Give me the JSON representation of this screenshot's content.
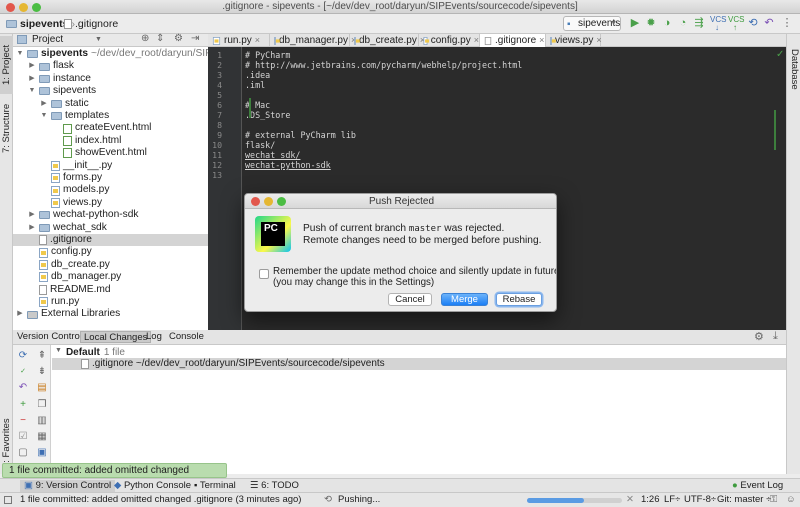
{
  "window": {
    "title": ".gitignore - sipevents - [~/dev/dev_root/daryun/SIPEvents/sourcecode/sipevents]"
  },
  "navbar": {
    "crumb1": "sipevents",
    "crumb2": ".gitignore",
    "run_config": "sipevents",
    "vcs_label": "VCS"
  },
  "left_strip": {
    "project": "1: Project",
    "structure": "7: Structure",
    "favorites": "2: Favorites"
  },
  "right_strip": {
    "database": "Database"
  },
  "project_panel": {
    "dropdown": "Project"
  },
  "tree": [
    {
      "label": "sipevents",
      "suffix": "~/dev/dev_root/daryun/SIPE",
      "type": "folder",
      "depth": 0,
      "open": true
    },
    {
      "label": "flask",
      "type": "folder",
      "depth": 1,
      "open": false
    },
    {
      "label": "instance",
      "type": "folder",
      "depth": 1,
      "open": false
    },
    {
      "label": "sipevents",
      "type": "folder",
      "depth": 1,
      "open": true
    },
    {
      "label": "static",
      "type": "folder",
      "depth": 2,
      "open": false
    },
    {
      "label": "templates",
      "type": "folder",
      "depth": 2,
      "open": true
    },
    {
      "label": "createEvent.html",
      "type": "html",
      "depth": 3
    },
    {
      "label": "index.html",
      "type": "html",
      "depth": 3
    },
    {
      "label": "showEvent.html",
      "type": "html",
      "depth": 3
    },
    {
      "label": "__init__.py",
      "type": "py",
      "depth": 2
    },
    {
      "label": "forms.py",
      "type": "py",
      "depth": 2
    },
    {
      "label": "models.py",
      "type": "py",
      "depth": 2
    },
    {
      "label": "views.py",
      "type": "py",
      "depth": 2
    },
    {
      "label": "wechat-python-sdk",
      "type": "folder",
      "depth": 1,
      "open": false
    },
    {
      "label": "wechat_sdk",
      "type": "folder",
      "depth": 1,
      "open": false
    },
    {
      "label": ".gitignore",
      "type": "file",
      "depth": 1,
      "selected": true
    },
    {
      "label": "config.py",
      "type": "py",
      "depth": 1
    },
    {
      "label": "db_create.py",
      "type": "py",
      "depth": 1
    },
    {
      "label": "db_manager.py",
      "type": "py",
      "depth": 1
    },
    {
      "label": "README.md",
      "type": "file",
      "depth": 1
    },
    {
      "label": "run.py",
      "type": "py",
      "depth": 1
    },
    {
      "label": "External Libraries",
      "type": "lib",
      "depth": 0,
      "open": false
    }
  ],
  "editor_tabs": [
    {
      "label": "run.py",
      "active": false
    },
    {
      "label": "db_manager.py",
      "active": false
    },
    {
      "label": "db_create.py",
      "active": false
    },
    {
      "label": "config.py",
      "active": false
    },
    {
      "label": ".gitignore",
      "active": true
    },
    {
      "label": "views.py",
      "active": false
    }
  ],
  "code_lines": [
    "# PyCharm",
    "# http://www.jetbrains.com/pycharm/webhelp/project.html",
    ".idea",
    ".iml",
    "",
    "# Mac",
    ".DS_Store",
    "",
    "# external PyCharm lib",
    "flask/",
    "wechat_sdk/",
    "wechat-python-sdk",
    ""
  ],
  "line_numbers": [
    "1",
    "2",
    "3",
    "4",
    "5",
    "6",
    "7",
    "8",
    "9",
    "10",
    "11",
    "12",
    "13"
  ],
  "dialog": {
    "title": "Push Rejected",
    "icon_text": "PC",
    "message_pre": "Push of current branch ",
    "message_branch": "master",
    "message_post": " was rejected.",
    "message2": "Remote changes need to be merged before pushing.",
    "checkbox_label": "Remember the update method choice and silently update in future",
    "checkbox_note": "(you may change this in the Settings)",
    "cancel": "Cancel",
    "merge": "Merge",
    "rebase": "Rebase"
  },
  "vc_panel": {
    "label": "Version Control:",
    "tabs": [
      "Local Changes",
      "Log",
      "Console"
    ],
    "group": "Default",
    "group_count": "1 file",
    "file": ".gitignore",
    "file_path": "~/dev/dev_root/daryun/SIPEvents/sourcecode/sipevents"
  },
  "toast": "1 file committed: added omitted changed .gitignore",
  "bottom_tabs": {
    "vc": "9: Version Control",
    "console": "Python Console",
    "terminal": "Terminal",
    "todo": "6: TODO",
    "event_log": "Event Log"
  },
  "status": {
    "message": "1 file committed: added omitted changed .gitignore (3 minutes ago)",
    "pushing": "Pushing...",
    "progress": 0.6,
    "position": "1:26",
    "line_sep": "LF÷",
    "encoding": "UTF-8÷",
    "branch": "Git: master ÷"
  }
}
